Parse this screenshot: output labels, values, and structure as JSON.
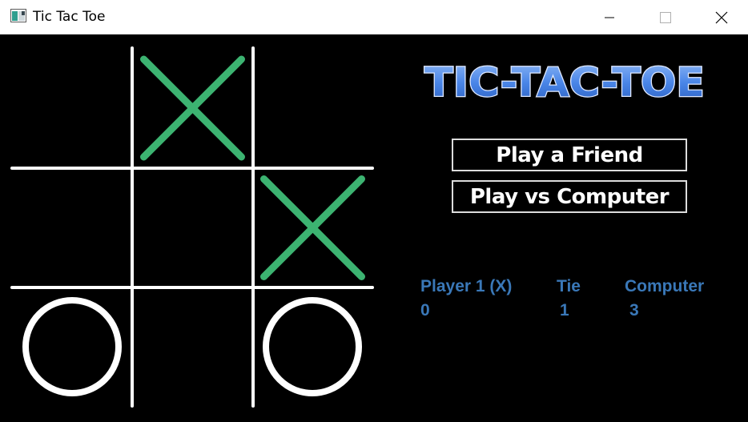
{
  "window": {
    "title": "Tic Tac Toe",
    "icon": "app-window-icon",
    "controls": [
      "minimize-icon",
      "maximize-icon",
      "close-icon"
    ]
  },
  "logo": {
    "text": "TIC-TAC-TOE",
    "color": "#4a86e8"
  },
  "menu": {
    "play_friend": "Play a Friend",
    "play_computer": "Play vs Computer"
  },
  "scoreboard": {
    "player1_label": "Player 1 (X)",
    "tie_label": "Tie",
    "computer_label": "Computer",
    "player1_score": "0",
    "tie_score": "1",
    "computer_score": "3",
    "color": "#3a78b8"
  },
  "board": {
    "cells": [
      [
        "",
        "X",
        ""
      ],
      [
        "",
        "",
        "X"
      ],
      [
        "O",
        "",
        "O"
      ]
    ],
    "x_color": "#3cb371",
    "o_color": "#ffffff",
    "grid_color": "#ffffff"
  }
}
